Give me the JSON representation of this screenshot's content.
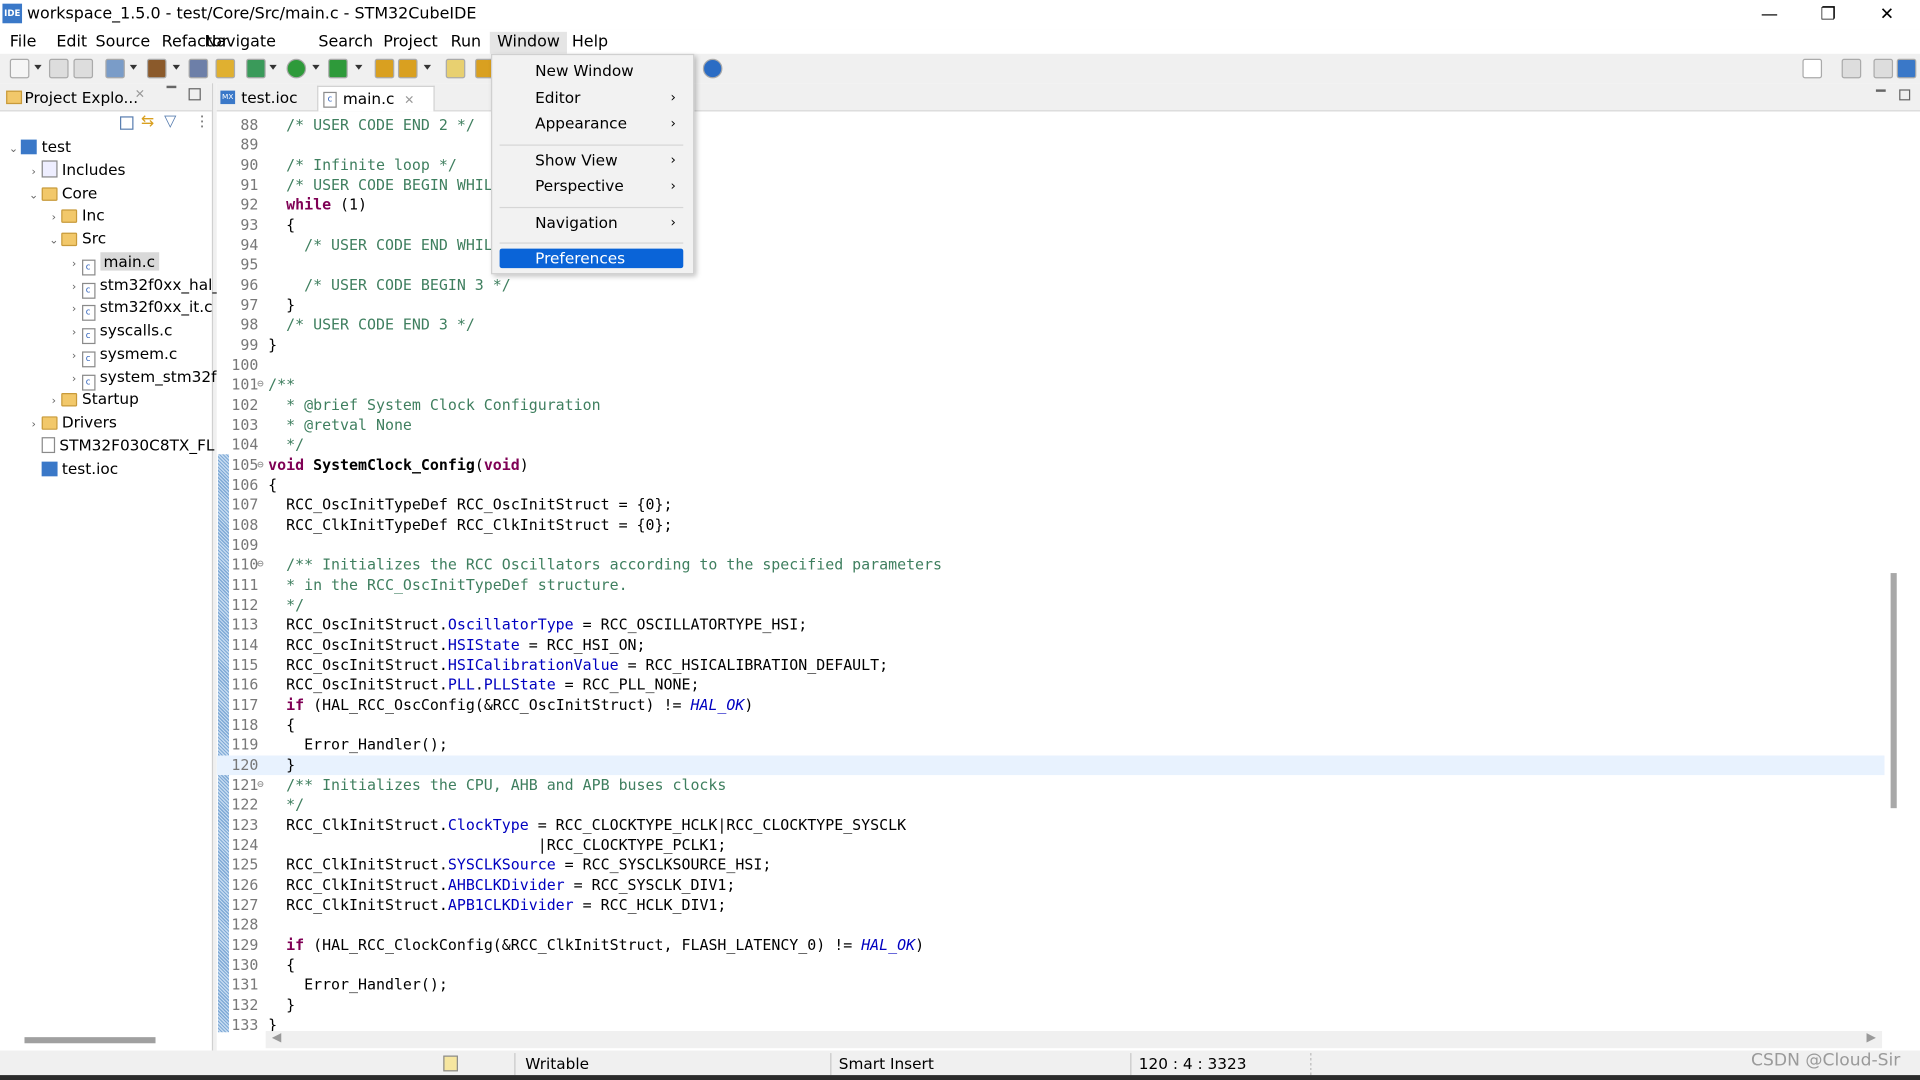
{
  "window": {
    "title": "workspace_1.5.0 - test/Core/Src/main.c - STM32CubeIDE",
    "app_icon": "IDE",
    "minimize": "—",
    "restore": "❐",
    "close": "✕"
  },
  "menubar": [
    "File",
    "Edit",
    "Source",
    "Refactor",
    "Navigate",
    "Search",
    "Project",
    "Run",
    "Window",
    "Help"
  ],
  "window_menu": {
    "items": [
      {
        "label": "New Window",
        "submenu": false
      },
      {
        "label": "Editor",
        "submenu": true
      },
      {
        "label": "Appearance",
        "submenu": true
      },
      {
        "sep": true
      },
      {
        "label": "Show View",
        "submenu": true
      },
      {
        "label": "Perspective",
        "submenu": true
      },
      {
        "sep": true
      },
      {
        "label": "Navigation",
        "submenu": true
      },
      {
        "sep": true
      },
      {
        "label": "Preferences",
        "submenu": false,
        "highlighted": true
      }
    ]
  },
  "explorer": {
    "title": "Project Explo...",
    "tree": [
      {
        "label": "test",
        "level": 0,
        "icon": "project-icon",
        "twisty": "open"
      },
      {
        "label": "Includes",
        "level": 1,
        "icon": "includes-icon",
        "twisty": "closed"
      },
      {
        "label": "Core",
        "level": 1,
        "icon": "source-folder-icon",
        "twisty": "open"
      },
      {
        "label": "Inc",
        "level": 2,
        "icon": "folder-icon",
        "twisty": "closed"
      },
      {
        "label": "Src",
        "level": 2,
        "icon": "folder-icon",
        "twisty": "open"
      },
      {
        "label": "main.c",
        "level": 3,
        "icon": "c-file-icon",
        "twisty": "closed",
        "selected": true
      },
      {
        "label": "stm32f0xx_hal_",
        "level": 3,
        "icon": "c-file-icon",
        "twisty": "closed"
      },
      {
        "label": "stm32f0xx_it.c",
        "level": 3,
        "icon": "c-file-icon",
        "twisty": "closed"
      },
      {
        "label": "syscalls.c",
        "level": 3,
        "icon": "c-file-icon",
        "twisty": "closed"
      },
      {
        "label": "sysmem.c",
        "level": 3,
        "icon": "c-file-icon",
        "twisty": "closed"
      },
      {
        "label": "system_stm32f",
        "level": 3,
        "icon": "c-file-icon",
        "twisty": "closed"
      },
      {
        "label": "Startup",
        "level": 2,
        "icon": "folder-icon",
        "twisty": "closed"
      },
      {
        "label": "Drivers",
        "level": 1,
        "icon": "folder-icon",
        "twisty": "closed"
      },
      {
        "label": "STM32F030C8TX_FL",
        "level": 1,
        "icon": "linker-file-icon",
        "twisty": ""
      },
      {
        "label": "test.ioc",
        "level": 1,
        "icon": "mx-file-icon",
        "twisty": ""
      }
    ]
  },
  "editor": {
    "tabs": [
      {
        "label": "test.ioc",
        "icon": "MX",
        "active": false
      },
      {
        "label": "main.c",
        "icon": "c",
        "active": true
      }
    ],
    "current_line": 120,
    "lines": [
      [
        88,
        [
          [
            "c",
            "  /* USER CODE END 2 */"
          ]
        ]
      ],
      [
        89,
        []
      ],
      [
        90,
        [
          [
            "c",
            "  /* Infinite loop */"
          ]
        ]
      ],
      [
        91,
        [
          [
            "c",
            "  /* USER CODE BEGIN WHILE */"
          ]
        ]
      ],
      [
        92,
        [
          [
            "p",
            "  "
          ],
          [
            "k",
            "while"
          ],
          [
            "p",
            " (1)"
          ]
        ]
      ],
      [
        93,
        [
          [
            "p",
            "  {"
          ]
        ]
      ],
      [
        94,
        [
          [
            "c",
            "    /* USER CODE END WHILE */"
          ]
        ]
      ],
      [
        95,
        []
      ],
      [
        96,
        [
          [
            "c",
            "    /* USER CODE BEGIN 3 */"
          ]
        ]
      ],
      [
        97,
        [
          [
            "p",
            "  }"
          ]
        ]
      ],
      [
        98,
        [
          [
            "c",
            "  /* USER CODE END 3 */"
          ]
        ]
      ],
      [
        99,
        [
          [
            "p",
            "}"
          ]
        ]
      ],
      [
        100,
        []
      ],
      [
        101,
        [
          [
            "c",
            "/**"
          ]
        ],
        true
      ],
      [
        102,
        [
          [
            "c",
            "  * @brief System Clock Configuration"
          ]
        ]
      ],
      [
        103,
        [
          [
            "c",
            "  * @retval None"
          ]
        ]
      ],
      [
        104,
        [
          [
            "c",
            "  */"
          ]
        ]
      ],
      [
        105,
        [
          [
            "k",
            "void"
          ],
          [
            "p",
            " "
          ],
          [
            "b",
            "SystemClock_Config"
          ],
          [
            "p",
            "("
          ],
          [
            "k",
            "void"
          ],
          [
            "p",
            ")"
          ]
        ],
        true
      ],
      [
        106,
        [
          [
            "p",
            "{"
          ]
        ]
      ],
      [
        107,
        [
          [
            "p",
            "  RCC_OscInitTypeDef RCC_OscInitStruct = {0};"
          ]
        ]
      ],
      [
        108,
        [
          [
            "p",
            "  RCC_ClkInitTypeDef RCC_ClkInitStruct = {0};"
          ]
        ]
      ],
      [
        109,
        []
      ],
      [
        110,
        [
          [
            "c",
            "  /** Initializes the RCC Oscillators according to the specified parameters"
          ]
        ],
        true
      ],
      [
        111,
        [
          [
            "c",
            "  * in the RCC_OscInitTypeDef structure."
          ]
        ]
      ],
      [
        112,
        [
          [
            "c",
            "  */"
          ]
        ]
      ],
      [
        113,
        [
          [
            "p",
            "  RCC_OscInitStruct."
          ],
          [
            "f",
            "OscillatorType"
          ],
          [
            "p",
            " = RCC_OSCILLATORTYPE_HSI;"
          ]
        ]
      ],
      [
        114,
        [
          [
            "p",
            "  RCC_OscInitStruct."
          ],
          [
            "f",
            "HSIState"
          ],
          [
            "p",
            " = RCC_HSI_ON;"
          ]
        ]
      ],
      [
        115,
        [
          [
            "p",
            "  RCC_OscInitStruct."
          ],
          [
            "f",
            "HSICalibrationValue"
          ],
          [
            "p",
            " = RCC_HSICALIBRATION_DEFAULT;"
          ]
        ]
      ],
      [
        116,
        [
          [
            "p",
            "  RCC_OscInitStruct."
          ],
          [
            "f",
            "PLL"
          ],
          [
            "p",
            "."
          ],
          [
            "f",
            "PLLState"
          ],
          [
            "p",
            " = RCC_PLL_NONE;"
          ]
        ]
      ],
      [
        117,
        [
          [
            "p",
            "  "
          ],
          [
            "k",
            "if"
          ],
          [
            "p",
            " (HAL_RCC_OscConfig(&RCC_OscInitStruct) != "
          ],
          [
            "i",
            "HAL_OK"
          ],
          [
            "p",
            ")"
          ]
        ]
      ],
      [
        118,
        [
          [
            "p",
            "  {"
          ]
        ]
      ],
      [
        119,
        [
          [
            "p",
            "    Error_Handler();"
          ]
        ]
      ],
      [
        120,
        [
          [
            "p",
            "  }"
          ]
        ]
      ],
      [
        121,
        [
          [
            "c",
            "  /** Initializes the CPU, AHB and APB buses clocks"
          ]
        ],
        true
      ],
      [
        122,
        [
          [
            "c",
            "  */"
          ]
        ]
      ],
      [
        123,
        [
          [
            "p",
            "  RCC_ClkInitStruct."
          ],
          [
            "f",
            "ClockType"
          ],
          [
            "p",
            " = RCC_CLOCKTYPE_HCLK|RCC_CLOCKTYPE_SYSCLK"
          ]
        ]
      ],
      [
        124,
        [
          [
            "p",
            "                              |RCC_CLOCKTYPE_PCLK1;"
          ]
        ]
      ],
      [
        125,
        [
          [
            "p",
            "  RCC_ClkInitStruct."
          ],
          [
            "f",
            "SYSCLKSource"
          ],
          [
            "p",
            " = RCC_SYSCLKSOURCE_HSI;"
          ]
        ]
      ],
      [
        126,
        [
          [
            "p",
            "  RCC_ClkInitStruct."
          ],
          [
            "f",
            "AHBCLKDivider"
          ],
          [
            "p",
            " = RCC_SYSCLK_DIV1;"
          ]
        ]
      ],
      [
        127,
        [
          [
            "p",
            "  RCC_ClkInitStruct."
          ],
          [
            "f",
            "APB1CLKDivider"
          ],
          [
            "p",
            " = RCC_HCLK_DIV1;"
          ]
        ]
      ],
      [
        128,
        []
      ],
      [
        129,
        [
          [
            "p",
            "  "
          ],
          [
            "k",
            "if"
          ],
          [
            "p",
            " (HAL_RCC_ClockConfig(&RCC_ClkInitStruct, FLASH_LATENCY_0) != "
          ],
          [
            "i",
            "HAL_OK"
          ],
          [
            "p",
            ")"
          ]
        ]
      ],
      [
        130,
        [
          [
            "p",
            "  {"
          ]
        ]
      ],
      [
        131,
        [
          [
            "p",
            "    Error_Handler();"
          ]
        ]
      ],
      [
        132,
        [
          [
            "p",
            "  }"
          ]
        ]
      ],
      [
        133,
        [
          [
            "p",
            "}"
          ]
        ]
      ]
    ]
  },
  "statusbar": {
    "mode": "Writable",
    "insert": "Smart Insert",
    "position": "120 : 4 : 3323"
  },
  "watermark": "CSDN @Cloud-Sir",
  "colors": {
    "comment": "#3f7f5f",
    "keyword": "#7f0055",
    "field": "#0000c0",
    "menu_highlight": "#0a64d8",
    "current_line": "#e8f2fe"
  }
}
